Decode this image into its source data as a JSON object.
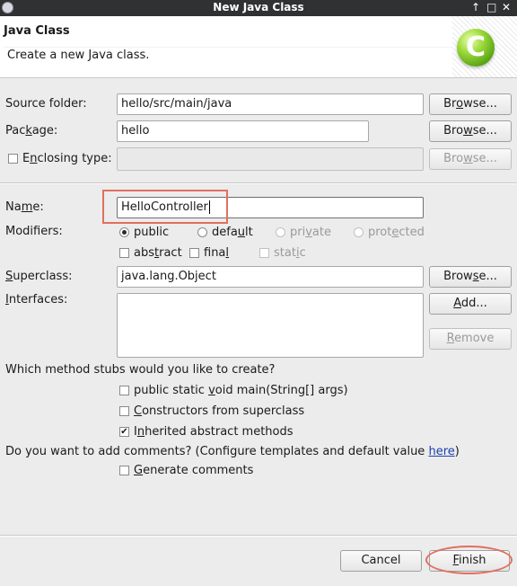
{
  "window": {
    "title": "New Java Class",
    "controls": [
      "↑",
      "□",
      "✕"
    ]
  },
  "banner": {
    "heading": "Java Class",
    "description": "Create a new Java class.",
    "icon_letter": "C"
  },
  "form": {
    "source_folder": {
      "label_pre": "Source folder:",
      "value": "hello/src/main/java",
      "browse": [
        "Br",
        "o",
        "wse..."
      ]
    },
    "package": {
      "label": [
        "Pac",
        "k",
        "age:"
      ],
      "value": "hello",
      "browse": [
        "Bro",
        "w",
        "se..."
      ]
    },
    "enclosing": {
      "label": [
        "E",
        "n",
        "closing type:"
      ],
      "value": "",
      "browse": [
        "Bro",
        "w",
        "se..."
      ]
    },
    "name": {
      "label": [
        "Na",
        "m",
        "e:"
      ],
      "value": "HelloController"
    },
    "modifiers": {
      "label": "Modifiers:",
      "public": "public",
      "default": [
        "defa",
        "u",
        "lt"
      ],
      "private": [
        "pri",
        "v",
        "ate"
      ],
      "protected": [
        "prot",
        "e",
        "cted"
      ],
      "abstract": [
        "abs",
        "t",
        "ract"
      ],
      "final": [
        "fina",
        "l",
        ""
      ],
      "static": [
        "stat",
        "i",
        "c"
      ]
    },
    "superclass": {
      "label": [
        "",
        "S",
        "uperclass:"
      ],
      "value": "java.lang.Object",
      "browse": [
        "Brow",
        "s",
        "e..."
      ]
    },
    "interfaces": {
      "label": [
        "",
        "I",
        "nterfaces:"
      ],
      "add": [
        "",
        "A",
        "dd..."
      ],
      "remove": [
        "",
        "R",
        "emove"
      ]
    }
  },
  "stubs": {
    "question": "Which method stubs would you like to create?",
    "main": [
      "public static ",
      "v",
      "oid main(String[] args)"
    ],
    "constructors": [
      "",
      "C",
      "onstructors from superclass"
    ],
    "inherited": [
      "I",
      "n",
      "herited abstract methods"
    ],
    "inherited_checked": true
  },
  "comments": {
    "question": "Do you want to add comments? (Configure templates and default value ",
    "link": "here",
    "close": ")",
    "generate": [
      "",
      "G",
      "enerate comments"
    ]
  },
  "footer": {
    "cancel": "Cancel",
    "finish": [
      "",
      "F",
      "inish"
    ]
  }
}
